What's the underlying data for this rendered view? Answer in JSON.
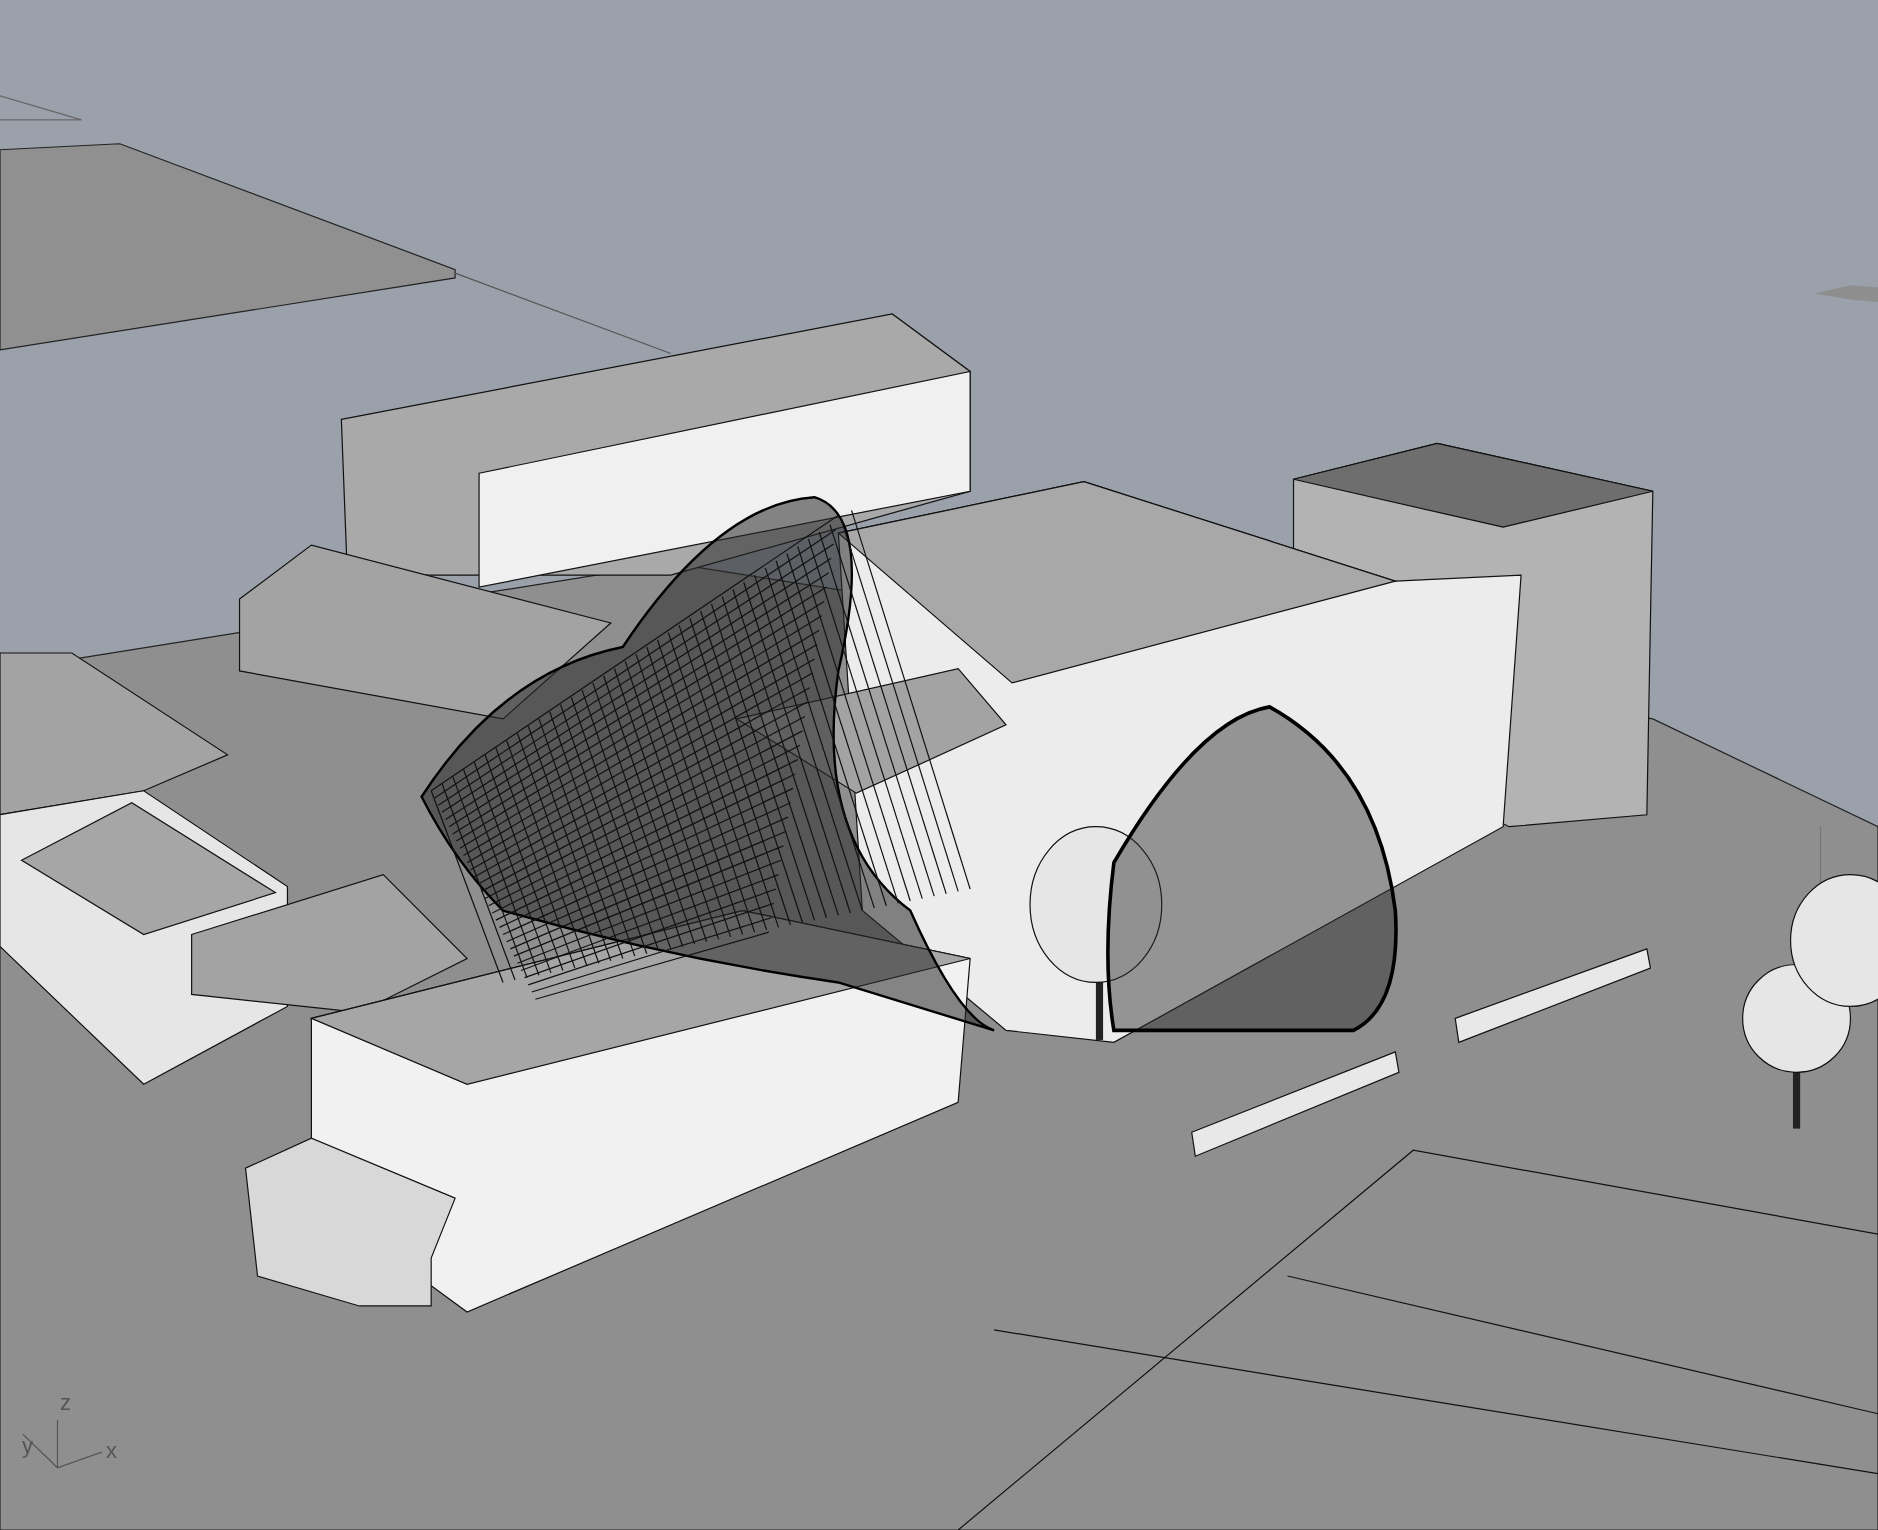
{
  "viewport": {
    "axis_widget": {
      "labels": [
        {
          "kind": "z",
          "text": "z"
        },
        {
          "kind": "y",
          "text": "y"
        },
        {
          "kind": "x",
          "text": "x"
        }
      ]
    }
  }
}
